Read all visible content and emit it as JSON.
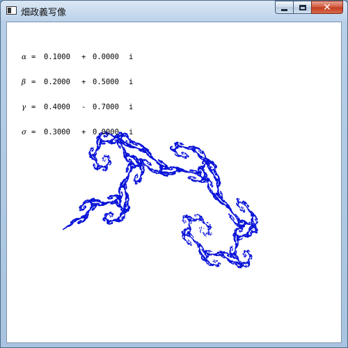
{
  "window": {
    "title": "畑政義写像",
    "buttons": {
      "minimize": "minimize",
      "maximize": "maximize",
      "close": "✕"
    }
  },
  "parameters": [
    {
      "symbol": "α",
      "eq": "=",
      "re": "0.1000",
      "sign": "+",
      "im": "0.0000",
      "unit": "i"
    },
    {
      "symbol": "β",
      "eq": "=",
      "re": "0.2000",
      "sign": "+",
      "im": "0.5000",
      "unit": "i"
    },
    {
      "symbol": "γ",
      "eq": "=",
      "re": "0.4000",
      "sign": "-",
      "im": "0.7000",
      "unit": "i"
    },
    {
      "symbol": "σ",
      "eq": "=",
      "re": "0.3000",
      "sign": "+",
      "im": "0.0000",
      "unit": "i"
    }
  ],
  "colors": {
    "fractal": "#0a14d8",
    "background": "#ffffff"
  }
}
